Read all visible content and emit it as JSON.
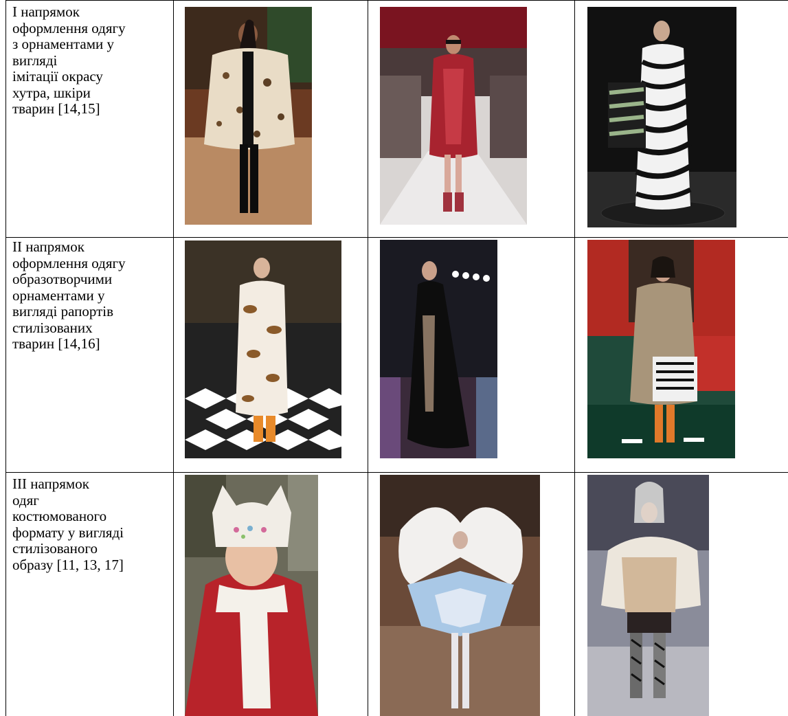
{
  "rows": [
    {
      "lines": [
        "І напрямок",
        "оформлення одягу",
        "з орнаментами у",
        "вигляді",
        "імітації окрасу",
        "хутра, шкіри",
        "тварин [14,15]"
      ],
      "images": [
        "runway-fur-coat-photo",
        "runway-red-snakeskin-coat-photo",
        "runway-zebra-print-dress-photo"
      ]
    },
    {
      "lines": [
        "ІІ напрямок",
        "оформлення одягу",
        "образотворчими",
        "орнаментами у",
        "вигляді рапортів",
        "стилізованих",
        "тварин [14,16]"
      ],
      "images": [
        "runway-leopard-print-coat-photo",
        "runway-black-sheer-gown-photo",
        "runway-khaki-hoodie-dress-photo"
      ]
    },
    {
      "lines": [
        "ІІІ напрямок",
        "одяг",
        "костюмованого",
        "формату у вигляді",
        "стилізованого",
        "образу [11, 13, 17]"
      ],
      "images": [
        "child-cat-hat-scarf-photo",
        "runway-white-bow-costume-photo",
        "runway-hooded-cape-costume-photo"
      ]
    }
  ]
}
